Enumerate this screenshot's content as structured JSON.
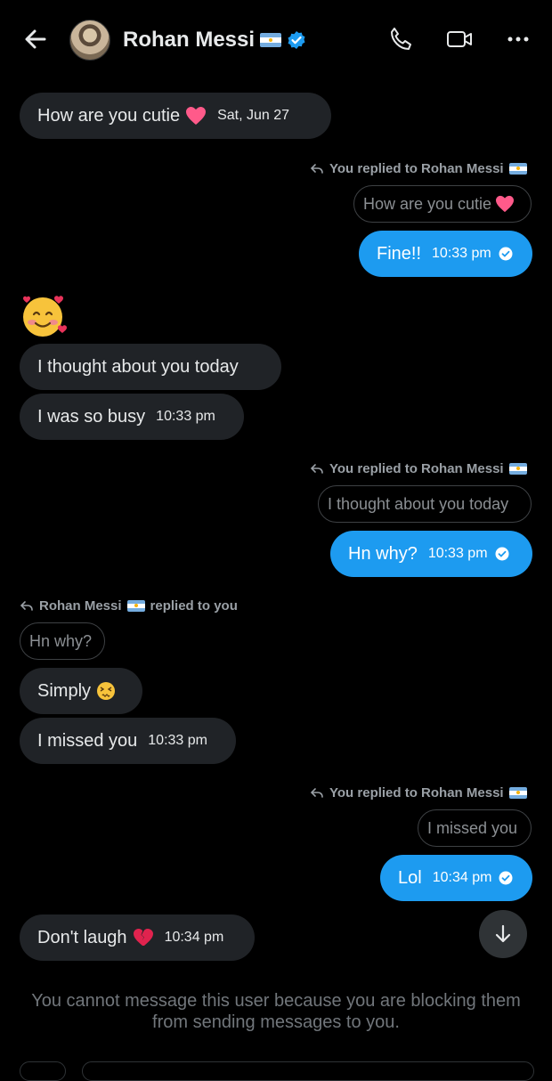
{
  "header": {
    "name": "Rohan Messi",
    "icons": [
      "back-arrow-icon",
      "flag-argentina-icon",
      "verified-badge-icon",
      "phone-icon",
      "video-camera-icon",
      "more-options-icon"
    ],
    "accent": "#1d9bf0"
  },
  "messages": [
    {
      "side": "in",
      "text": "How are you cutie",
      "emoji": "pink-heart",
      "time": "Sat, Jun 27"
    },
    {
      "side": "out",
      "reply_note": "You replied to Rohan Messi",
      "quote": "How are you cutie",
      "text": "Fine!!",
      "time": "10:33 pm"
    },
    {
      "side": "in",
      "emoji_only": "smiling-face-with-hearts"
    },
    {
      "side": "in",
      "text": "I thought about you today"
    },
    {
      "side": "in",
      "text": "I was so busy",
      "time": "10:33 pm"
    },
    {
      "side": "out",
      "reply_note": "You replied to Rohan Messi",
      "quote": "I thought about you today",
      "text": "Hn why?",
      "time": "10:33 pm"
    },
    {
      "side": "in",
      "reply_note": "Rohan Messi",
      "reply_note_suffix": "replied to you",
      "quote": "Hn why?",
      "text": "Simply",
      "emoji": "persevering-face"
    },
    {
      "side": "in",
      "text": "I missed you",
      "time": "10:33 pm"
    },
    {
      "side": "out",
      "reply_note": "You replied to Rohan Messi",
      "quote": "I missed you",
      "text": "Lol",
      "time": "10:34 pm"
    },
    {
      "side": "in",
      "text": "Don't laugh",
      "emoji": "broken-heart",
      "time": "10:34 pm"
    }
  ],
  "footer": {
    "notice": "You cannot message this user because you are blocking them from sending messages to you."
  },
  "colors": {
    "background": "#000000",
    "incoming_bubble": "#202327",
    "outgoing_bubble": "#1d9bf0",
    "muted_text": "#71767b"
  }
}
